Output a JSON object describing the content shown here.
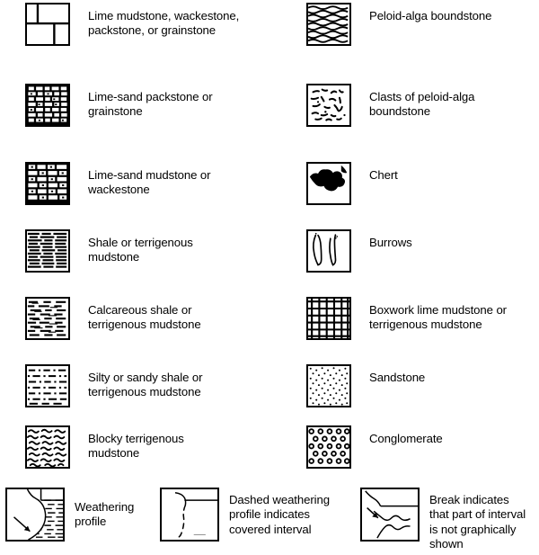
{
  "figure": {
    "kind": "lithology-legend",
    "background_color": "#ffffff",
    "ink_color": "#000000",
    "columns": 2,
    "rows_per_column": 7
  },
  "left_column": [
    {
      "pattern": "lime-mudstone-brick-blocks",
      "label": "Lime mudstone, wackestone,\npackstone, or grainstone"
    },
    {
      "pattern": "lime-sand-packstone-dense-brick-dots",
      "label": "Lime-sand packstone or\ngrainstone"
    },
    {
      "pattern": "lime-sand-mudstone-brick-dots",
      "label": "Lime-sand mudstone or\nwackestone"
    },
    {
      "pattern": "shale-dense-dashes",
      "label": "Shale or terrigenous\nmudstone"
    },
    {
      "pattern": "calcareous-shale-dashes-lines",
      "label": "Calcareous shale or\nterrigenous mudstone"
    },
    {
      "pattern": "silty-sandy-shale-dot-dash",
      "label": "Silty or sandy shale or\nterrigenous mudstone"
    },
    {
      "pattern": "blocky-terrigenous-squiggles",
      "label": "Blocky terrigenous\nmudstone"
    }
  ],
  "right_column": [
    {
      "pattern": "peloid-alga-wavy-lines",
      "label": "Peloid-alga boundstone"
    },
    {
      "pattern": "clasts-of-peloid-alga-flecks",
      "label": "Clasts of peloid-alga\nboundstone"
    },
    {
      "pattern": "chert-solid-blob",
      "label": "Chert"
    },
    {
      "pattern": "burrows-tubes",
      "label": "Burrows"
    },
    {
      "pattern": "boxwork-grid",
      "label": "Boxwork lime mudstone or\nterrigenous mudstone"
    },
    {
      "pattern": "sandstone-stipple",
      "label": "Sandstone"
    },
    {
      "pattern": "conglomerate-circles",
      "label": "Conglomerate"
    }
  ],
  "bottom_notes": [
    {
      "pattern": "weathering-profile-solid-with-arrow",
      "label": "Weathering\nprofile"
    },
    {
      "pattern": "dashed-weathering-profile",
      "label": "Dashed weathering\nprofile indicates\ncovered interval"
    },
    {
      "pattern": "break-in-section-with-arrow",
      "label": "Break indicates\nthat part of interval\nis not graphically\nshown"
    }
  ]
}
